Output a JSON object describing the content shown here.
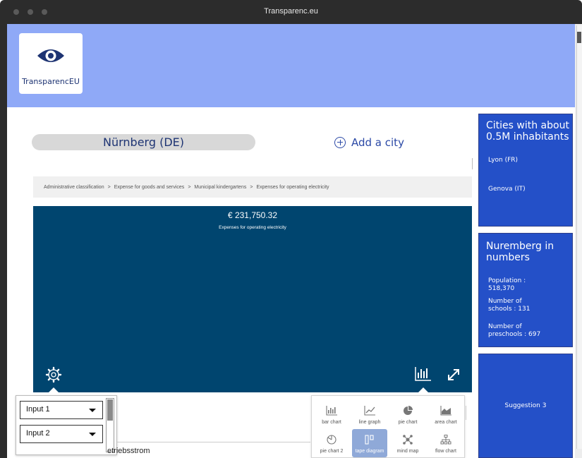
{
  "window": {
    "title": "Transparenc.eu"
  },
  "header": {
    "logo_text": "TransparencEU",
    "brand_color": "#8fa9f7"
  },
  "city_selector": {
    "current_city": "Nürnberg (DE)",
    "add_city_label": "Add a city"
  },
  "breadcrumb": {
    "items": [
      "Administrative classification",
      "Expense for goods and services",
      "Municipal kindergartens",
      "Expenses for operating electricity"
    ],
    "separator": ">"
  },
  "main_chart": {
    "amount": "€ 231,750.32",
    "label": "Expenses for operating electricity",
    "background_color": "#00456f"
  },
  "inputs": {
    "input1": "Input 1",
    "input2": "Input 2"
  },
  "table": {
    "row_text": "etriebsstrom"
  },
  "chart_types": [
    {
      "label": "bar chart",
      "icon": "bar-chart-icon",
      "active": false
    },
    {
      "label": "line graph",
      "icon": "line-graph-icon",
      "active": false
    },
    {
      "label": "pie chart",
      "icon": "pie-chart-icon",
      "active": false
    },
    {
      "label": "area chart",
      "icon": "area-chart-icon",
      "active": false
    },
    {
      "label": "pie chart 2",
      "icon": "pie-chart-2-icon",
      "active": false
    },
    {
      "label": "tape diagram",
      "icon": "tape-diagram-icon",
      "active": true
    },
    {
      "label": "mind map",
      "icon": "mind-map-icon",
      "active": false
    },
    {
      "label": "flow chart",
      "icon": "flow-chart-icon",
      "active": false
    }
  ],
  "sidebar": {
    "similar_cities": {
      "title": "Cities with about 0.5M inhabitants",
      "cities": [
        "Lyon (FR)",
        "Genova (IT)"
      ]
    },
    "city_numbers": {
      "title": "Nuremberg in numbers",
      "population": "Population : 518,370",
      "schools": "Number of schools : 131",
      "preschools": "Number of preschools : 697"
    },
    "suggestion": {
      "label": "Suggestion 3"
    },
    "box_color": "#2450c8"
  }
}
